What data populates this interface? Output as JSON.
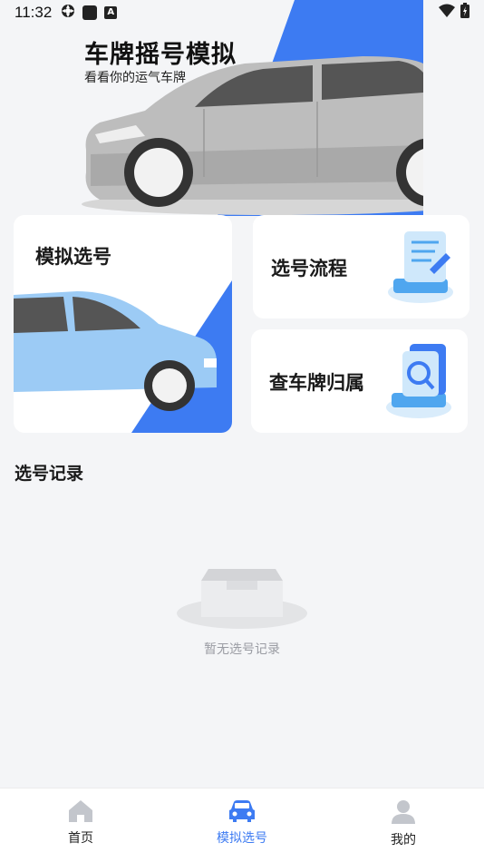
{
  "status_bar": {
    "time": "11:32",
    "left_icons": [
      "settings-icon",
      "app-square-icon",
      "a-icon"
    ],
    "right_icons": [
      "wifi-icon",
      "battery-icon"
    ]
  },
  "hero": {
    "title": "车牌摇号模拟",
    "subtitle": "看看你的运气车牌",
    "accent_color": "#3d7bf2"
  },
  "cards": {
    "simulate": {
      "label": "模拟选号"
    },
    "flow": {
      "label": "选号流程"
    },
    "belong": {
      "label": "查车牌归属"
    }
  },
  "records": {
    "title": "选号记录",
    "empty_text": "暂无选号记录"
  },
  "bottom_nav": {
    "items": [
      {
        "label": "首页",
        "icon": "home-icon",
        "active": false
      },
      {
        "label": "模拟选号",
        "icon": "car-icon",
        "active": true
      },
      {
        "label": "我的",
        "icon": "user-icon",
        "active": false
      }
    ],
    "active_color": "#3d7bf2"
  }
}
